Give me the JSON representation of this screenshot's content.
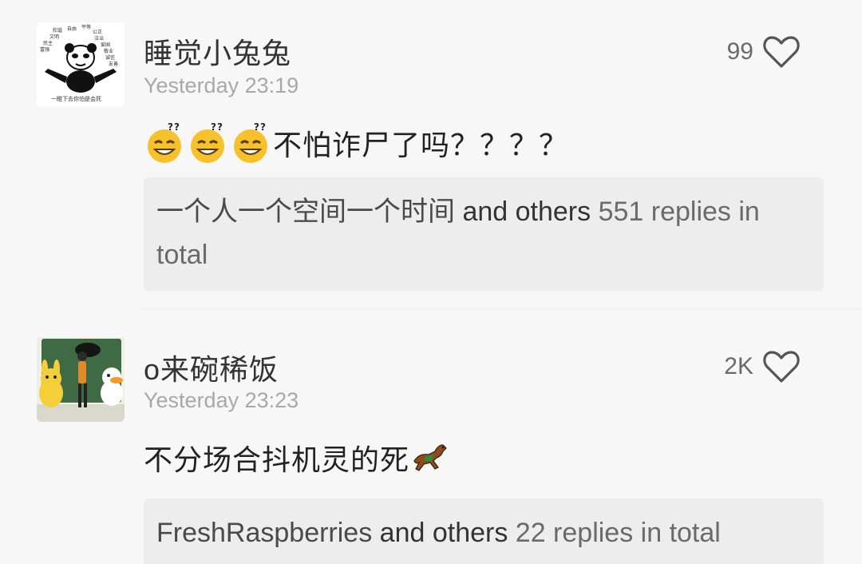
{
  "comments": [
    {
      "username": "睡觉小兔兔",
      "timestamp": "Yesterday 23:19",
      "likes": "99",
      "text": "不怕诈尸了吗？？？？",
      "emoji_prefix": [
        "thinking-grin-emoji",
        "thinking-grin-emoji",
        "thinking-grin-emoji"
      ],
      "avatar": {
        "icon": "panda-meme-avatar",
        "caption": "一瞪下去你怕是会死",
        "words": [
          "和谐",
          "自由",
          "平等",
          "公正",
          "文明",
          "法治",
          "民主",
          "爱国",
          "富强",
          "敬业",
          "诚信",
          "友善"
        ]
      },
      "replies": {
        "names": "一个人一个空间一个时间",
        "connector": "and others",
        "count": "551 replies in total"
      }
    },
    {
      "username": "o来碗稀饭",
      "timestamp": "Yesterday 23:23",
      "likes": "2K",
      "text": "不分场合抖机灵的死",
      "emoji_suffix": "horse-emoji",
      "avatar": {
        "icon": "photo-avatar"
      },
      "replies": {
        "names": "FreshRaspberries",
        "connector": "and others",
        "count": "22 replies in total"
      }
    }
  ],
  "colors": {
    "background": "#f7f7f7",
    "reply_box": "#ededed",
    "timestamp": "#a8a8a8",
    "heart_stroke": "#555555"
  }
}
